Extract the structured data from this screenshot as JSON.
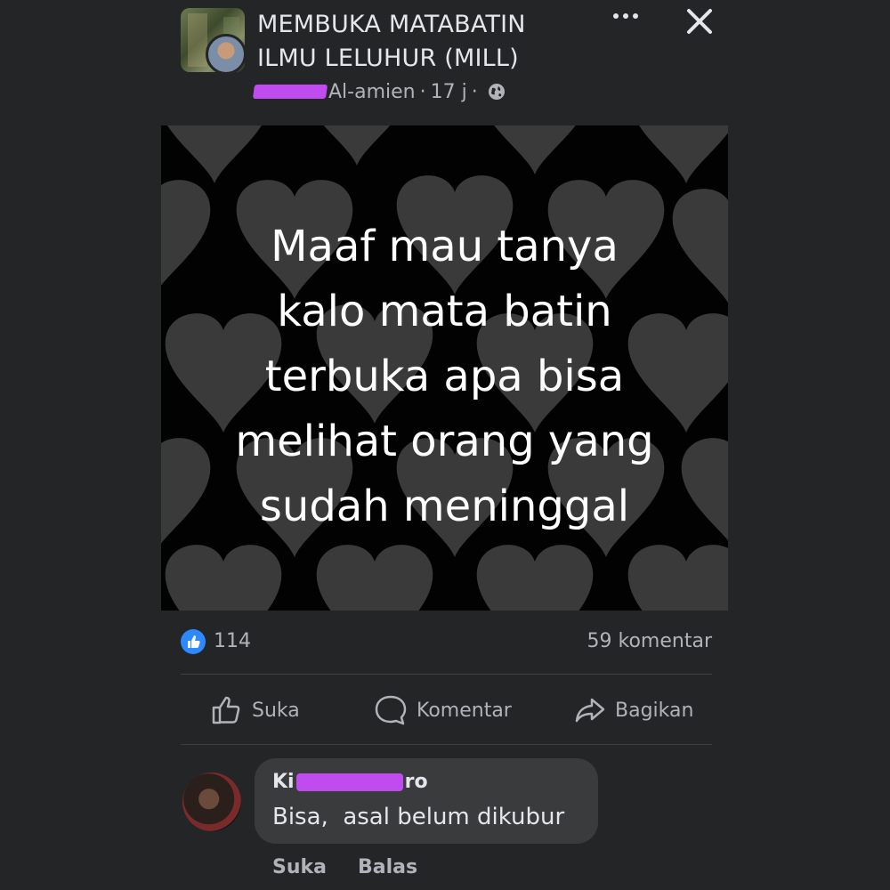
{
  "header": {
    "group_title": "MEMBUKA MATABATIN\nILMU LELUHUR (MILL)",
    "author_visible": "Al-amien",
    "time": "17 j",
    "separator": "·",
    "more_icon": "more-icon",
    "close_icon": "close-icon",
    "privacy_icon": "globe-icon"
  },
  "post": {
    "text": "Maaf mau tanya\nkalo mata batin\nterbuka apa bisa\nmelihat orang yang\nsudah meninggal",
    "background": "black-with-grey-hearts"
  },
  "stats": {
    "likes": "114",
    "comments": "59 komentar"
  },
  "actions": {
    "like": "Suka",
    "comment": "Komentar",
    "share": "Bagikan"
  },
  "comment": {
    "author_prefix": "Ki",
    "author_suffix": "ro",
    "text": "Bisa,  asal belum dikubur",
    "like": "Suka",
    "reply": "Balas"
  },
  "colors": {
    "background": "#242526",
    "bubble": "#3a3b3c",
    "accent_blue": "#2e89ff",
    "redaction": "#c04cf0"
  }
}
